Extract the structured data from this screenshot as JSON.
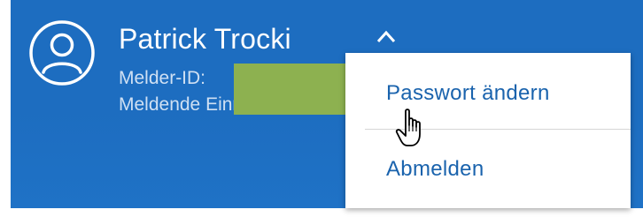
{
  "user": {
    "name": "Patrick Trocki",
    "id_label": "Melder-ID:",
    "role_label": "Meldende Einrichtung"
  },
  "menu": {
    "items": [
      {
        "label": "Passwort ändern"
      },
      {
        "label": "Abmelden"
      }
    ]
  },
  "icons": {
    "avatar": "user-circle-icon",
    "toggle": "chevron-up-icon",
    "cursor": "hand-pointer-cursor"
  },
  "colors": {
    "header_bg": "#1d6dc0",
    "menu_text": "#1a63ad",
    "redaction": "#8db150"
  }
}
